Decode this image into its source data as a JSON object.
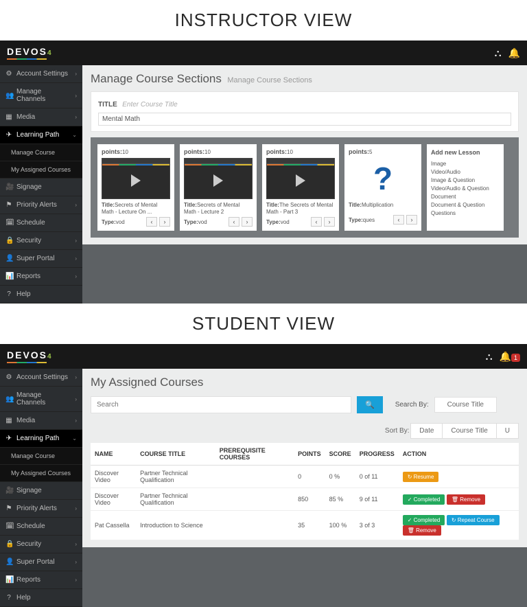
{
  "headings": {
    "instructor": "INSTRUCTOR VIEW",
    "student": "STUDENT VIEW"
  },
  "logo": "DEVOS",
  "logo_suffix": "4",
  "topbar": {
    "notif_count": "1"
  },
  "sidebar": {
    "items": [
      {
        "icon": "⚙",
        "label": "Account Settings",
        "chev": "›"
      },
      {
        "icon": "👥",
        "label": "Manage Channels",
        "chev": "›"
      },
      {
        "icon": "▦",
        "label": "Media",
        "chev": "›"
      },
      {
        "icon": "✈",
        "label": "Learning Path",
        "chev": "⌄",
        "dark": true
      },
      {
        "icon": "",
        "label": "Manage Course",
        "sub": true,
        "active": true
      },
      {
        "icon": "",
        "label": "My Assigned Courses",
        "sub": true
      },
      {
        "icon": "🎥",
        "label": "Signage",
        "chev": ""
      },
      {
        "icon": "⚑",
        "label": "Priority Alerts",
        "chev": "›"
      },
      {
        "icon": "🗓",
        "label": "Schedule",
        "chev": ""
      },
      {
        "icon": "🔒",
        "label": "Security",
        "chev": "›"
      },
      {
        "icon": "👤",
        "label": "Super Portal",
        "chev": "›"
      },
      {
        "icon": "📊",
        "label": "Reports",
        "chev": "›"
      },
      {
        "icon": "?",
        "label": "Help",
        "chev": ""
      }
    ]
  },
  "instructor": {
    "title": "Manage Course Sections",
    "breadcrumb": "Manage Course Sections",
    "title_label": "TITLE",
    "title_placeholder": "Enter Course Title",
    "title_value": "Mental Math",
    "points_label": "points:",
    "title_prefix": "Title:",
    "type_prefix": "Type:",
    "cards": [
      {
        "points": "10",
        "title": "Secrets of Mental Math - Lecture On ...",
        "type": "vod",
        "media": "video"
      },
      {
        "points": "10",
        "title": "Secrets of Mental Math - Lecture 2",
        "type": "vod",
        "media": "video"
      },
      {
        "points": "10",
        "title": "The Secrets of Mental Math - Part 3",
        "type": "vod",
        "media": "video"
      },
      {
        "points": "5",
        "title": "Multiplication",
        "type": "ques",
        "media": "question"
      }
    ],
    "add_card": {
      "header": "Add new Lesson",
      "opts": [
        "Image",
        "Video/Audio",
        "Image & Question",
        "Video/Audio & Question",
        "Document",
        "Document & Question",
        "Questions"
      ]
    }
  },
  "student": {
    "title": "My Assigned Courses",
    "search_placeholder": "Search",
    "search_by_label": "Search By:",
    "search_by_value": "Course Title",
    "sort_by_label": "Sort By:",
    "sort_tabs": [
      "Date",
      "Course Title",
      "U"
    ],
    "columns": [
      "NAME",
      "COURSE TITLE",
      "PREREQUISITE COURSES",
      "POINTS",
      "SCORE",
      "PROGRESS",
      "ACTION"
    ],
    "rows": [
      {
        "name": "Discover Video",
        "course": "Partner Technical Qualification",
        "prereq": "",
        "points": "0",
        "score": "0 %",
        "progress": "0 of 11",
        "actions": [
          {
            "t": "↻ Resume",
            "c": "b-orange"
          }
        ]
      },
      {
        "name": "Discover Video",
        "course": "Partner Technical Qualification",
        "prereq": "",
        "points": "850",
        "score": "85 %",
        "progress": "9 of 11",
        "actions": [
          {
            "t": "✓ Completed",
            "c": "b-green"
          },
          {
            "t": "🗑 Remove",
            "c": "b-red"
          }
        ]
      },
      {
        "name": "Pat Cassella",
        "course": "Introduction to Science",
        "prereq": "",
        "points": "35",
        "score": "100 %",
        "progress": "3 of 3",
        "actions": [
          {
            "t": "✓ Completed",
            "c": "b-green"
          },
          {
            "t": "↻ Repeat Course",
            "c": "b-blue"
          },
          {
            "t": "🗑 Remove",
            "c": "b-red"
          }
        ]
      }
    ]
  }
}
